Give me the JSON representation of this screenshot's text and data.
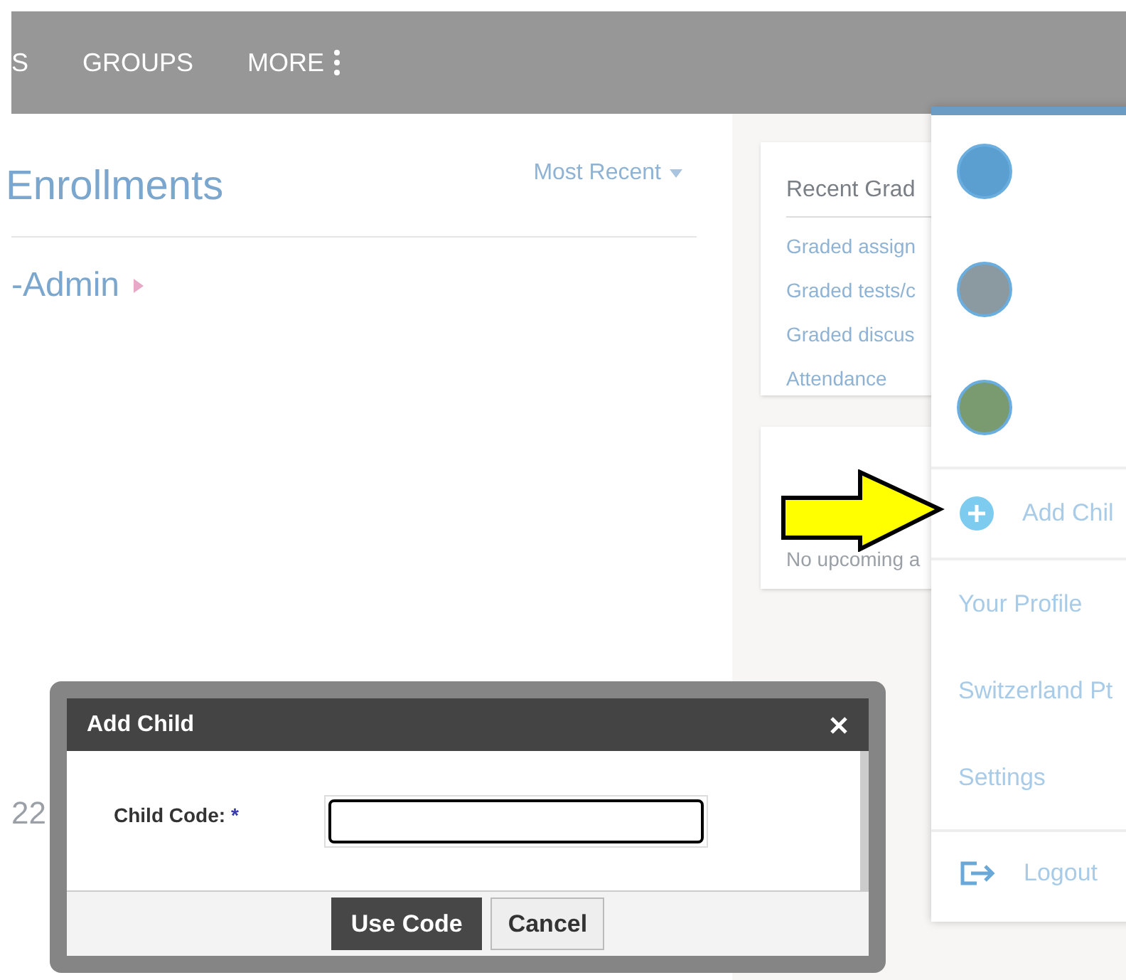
{
  "nav": {
    "items": [
      "S",
      "GROUPS",
      "MORE"
    ]
  },
  "enrollments": {
    "title": "Enrollments",
    "sort": "Most Recent",
    "course": "-Admin",
    "year_fragment": "22"
  },
  "recent_grades": {
    "title": "Recent Grad",
    "links": [
      "Graded assign",
      "Graded tests/c",
      "Graded discus",
      "Attendance"
    ]
  },
  "upcoming": {
    "text": "No upcoming a"
  },
  "account_menu": {
    "add_child": "Add Chil",
    "items": [
      "Your Profile",
      "Switzerland Pt",
      "Settings"
    ],
    "logout": "Logout"
  },
  "dialog": {
    "title": "Add Child",
    "field_label": "Child Code:",
    "required_mark": "*",
    "buttons": [
      {
        "label": "Use Code",
        "kind": "primary"
      },
      {
        "label": "Cancel",
        "kind": "secondary"
      }
    ]
  }
}
